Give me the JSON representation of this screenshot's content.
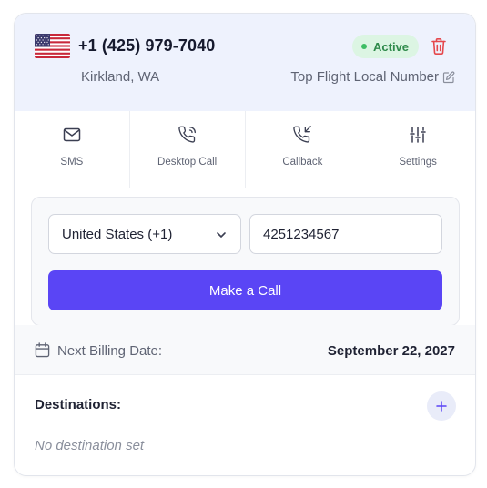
{
  "header": {
    "flag_icon": "us-flag-icon",
    "phone_number": "+1 (425) 979-7040",
    "status": "Active",
    "status_color": "#3ebd64",
    "location": "Kirkland, WA",
    "number_name": "Top Flight Local Number"
  },
  "actions": [
    {
      "label": "SMS",
      "icon": "mail-icon"
    },
    {
      "label": "Desktop Call",
      "icon": "phone-call-icon"
    },
    {
      "label": "Callback",
      "icon": "phone-incoming-icon"
    },
    {
      "label": "Settings",
      "icon": "sliders-icon"
    }
  ],
  "dialer": {
    "country": "United States (+1)",
    "phone_value": "4251234567",
    "call_button": "Make a Call",
    "accent_color": "#5a45f5"
  },
  "billing": {
    "label": "Next Billing Date:",
    "date": "September 22, 2027"
  },
  "destinations": {
    "title": "Destinations:",
    "empty_text": "No destination set"
  }
}
